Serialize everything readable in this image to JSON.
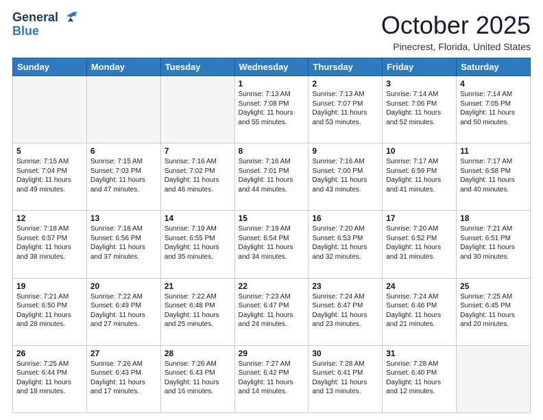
{
  "logo": {
    "line1": "General",
    "line2": "Blue"
  },
  "title": "October 2025",
  "location": "Pinecrest, Florida, United States",
  "headers": [
    "Sunday",
    "Monday",
    "Tuesday",
    "Wednesday",
    "Thursday",
    "Friday",
    "Saturday"
  ],
  "weeks": [
    [
      {
        "day": "",
        "info": ""
      },
      {
        "day": "",
        "info": ""
      },
      {
        "day": "",
        "info": ""
      },
      {
        "day": "1",
        "info": "Sunrise: 7:13 AM\nSunset: 7:08 PM\nDaylight: 11 hours\nand 55 minutes."
      },
      {
        "day": "2",
        "info": "Sunrise: 7:13 AM\nSunset: 7:07 PM\nDaylight: 11 hours\nand 53 minutes."
      },
      {
        "day": "3",
        "info": "Sunrise: 7:14 AM\nSunset: 7:06 PM\nDaylight: 11 hours\nand 52 minutes."
      },
      {
        "day": "4",
        "info": "Sunrise: 7:14 AM\nSunset: 7:05 PM\nDaylight: 11 hours\nand 50 minutes."
      }
    ],
    [
      {
        "day": "5",
        "info": "Sunrise: 7:15 AM\nSunset: 7:04 PM\nDaylight: 11 hours\nand 49 minutes."
      },
      {
        "day": "6",
        "info": "Sunrise: 7:15 AM\nSunset: 7:03 PM\nDaylight: 11 hours\nand 47 minutes."
      },
      {
        "day": "7",
        "info": "Sunrise: 7:16 AM\nSunset: 7:02 PM\nDaylight: 11 hours\nand 46 minutes."
      },
      {
        "day": "8",
        "info": "Sunrise: 7:16 AM\nSunset: 7:01 PM\nDaylight: 11 hours\nand 44 minutes."
      },
      {
        "day": "9",
        "info": "Sunrise: 7:16 AM\nSunset: 7:00 PM\nDaylight: 11 hours\nand 43 minutes."
      },
      {
        "day": "10",
        "info": "Sunrise: 7:17 AM\nSunset: 6:59 PM\nDaylight: 11 hours\nand 41 minutes."
      },
      {
        "day": "11",
        "info": "Sunrise: 7:17 AM\nSunset: 6:58 PM\nDaylight: 11 hours\nand 40 minutes."
      }
    ],
    [
      {
        "day": "12",
        "info": "Sunrise: 7:18 AM\nSunset: 6:57 PM\nDaylight: 11 hours\nand 38 minutes."
      },
      {
        "day": "13",
        "info": "Sunrise: 7:18 AM\nSunset: 6:56 PM\nDaylight: 11 hours\nand 37 minutes."
      },
      {
        "day": "14",
        "info": "Sunrise: 7:19 AM\nSunset: 6:55 PM\nDaylight: 11 hours\nand 35 minutes."
      },
      {
        "day": "15",
        "info": "Sunrise: 7:19 AM\nSunset: 6:54 PM\nDaylight: 11 hours\nand 34 minutes."
      },
      {
        "day": "16",
        "info": "Sunrise: 7:20 AM\nSunset: 6:53 PM\nDaylight: 11 hours\nand 32 minutes."
      },
      {
        "day": "17",
        "info": "Sunrise: 7:20 AM\nSunset: 6:52 PM\nDaylight: 11 hours\nand 31 minutes."
      },
      {
        "day": "18",
        "info": "Sunrise: 7:21 AM\nSunset: 6:51 PM\nDaylight: 11 hours\nand 30 minutes."
      }
    ],
    [
      {
        "day": "19",
        "info": "Sunrise: 7:21 AM\nSunset: 6:50 PM\nDaylight: 11 hours\nand 28 minutes."
      },
      {
        "day": "20",
        "info": "Sunrise: 7:22 AM\nSunset: 6:49 PM\nDaylight: 11 hours\nand 27 minutes."
      },
      {
        "day": "21",
        "info": "Sunrise: 7:22 AM\nSunset: 6:48 PM\nDaylight: 11 hours\nand 25 minutes."
      },
      {
        "day": "22",
        "info": "Sunrise: 7:23 AM\nSunset: 6:47 PM\nDaylight: 11 hours\nand 24 minutes."
      },
      {
        "day": "23",
        "info": "Sunrise: 7:24 AM\nSunset: 6:47 PM\nDaylight: 11 hours\nand 23 minutes."
      },
      {
        "day": "24",
        "info": "Sunrise: 7:24 AM\nSunset: 6:46 PM\nDaylight: 11 hours\nand 21 minutes."
      },
      {
        "day": "25",
        "info": "Sunrise: 7:25 AM\nSunset: 6:45 PM\nDaylight: 11 hours\nand 20 minutes."
      }
    ],
    [
      {
        "day": "26",
        "info": "Sunrise: 7:25 AM\nSunset: 6:44 PM\nDaylight: 11 hours\nand 18 minutes."
      },
      {
        "day": "27",
        "info": "Sunrise: 7:26 AM\nSunset: 6:43 PM\nDaylight: 11 hours\nand 17 minutes."
      },
      {
        "day": "28",
        "info": "Sunrise: 7:26 AM\nSunset: 6:43 PM\nDaylight: 11 hours\nand 16 minutes."
      },
      {
        "day": "29",
        "info": "Sunrise: 7:27 AM\nSunset: 6:42 PM\nDaylight: 11 hours\nand 14 minutes."
      },
      {
        "day": "30",
        "info": "Sunrise: 7:28 AM\nSunset: 6:41 PM\nDaylight: 11 hours\nand 13 minutes."
      },
      {
        "day": "31",
        "info": "Sunrise: 7:28 AM\nSunset: 6:40 PM\nDaylight: 11 hours\nand 12 minutes."
      },
      {
        "day": "",
        "info": ""
      }
    ]
  ]
}
